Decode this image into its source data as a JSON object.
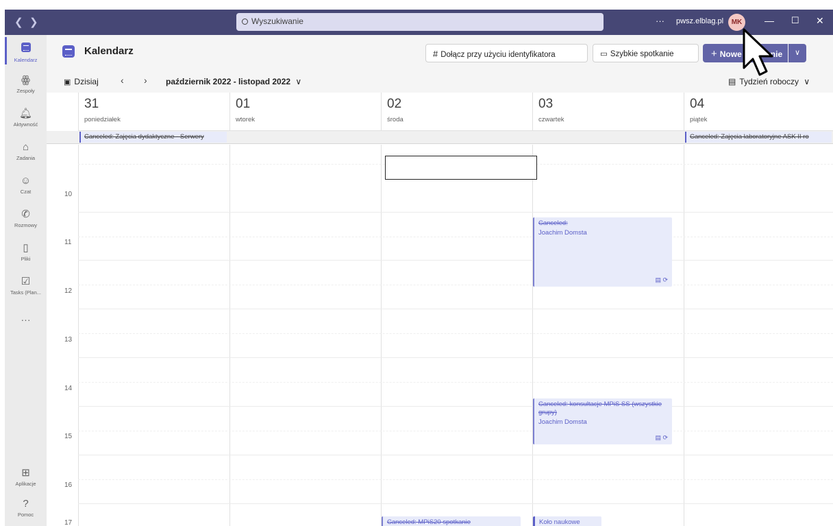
{
  "titlebar": {
    "back_icon": "chevron-left",
    "forward_icon": "chevron-right",
    "search_placeholder": "Wyszukiwanie",
    "more": "···",
    "tenant": "pwsz.elblag.pl",
    "avatar_initials": "MK",
    "minimize": "—",
    "maximize": "☐",
    "close": "✕"
  },
  "rail": {
    "items": [
      {
        "label": "Kalendarz",
        "icon": "calendar-icon",
        "glyph": "▦"
      },
      {
        "label": "Zespoły",
        "icon": "teams-icon",
        "glyph": "ꙮ"
      },
      {
        "label": "Aktywność",
        "icon": "bell-icon",
        "glyph": "🔔︎"
      },
      {
        "label": "Zadania",
        "icon": "tasks-icon",
        "glyph": "⌂"
      },
      {
        "label": "Czat",
        "icon": "chat-icon",
        "glyph": "☺"
      },
      {
        "label": "Rozmowy",
        "icon": "phone-icon",
        "glyph": "✆"
      },
      {
        "label": "Pliki",
        "icon": "file-icon",
        "glyph": "▯"
      },
      {
        "label": "Tasks (Plan...",
        "icon": "planner-icon",
        "glyph": "☑"
      }
    ],
    "more": "···",
    "apps": {
      "label": "Aplikacje",
      "icon": "apps-icon",
      "glyph": "⊞"
    },
    "help": {
      "label": "Pomoc",
      "icon": "help-icon",
      "glyph": "?"
    }
  },
  "header": {
    "title": "Kalendarz",
    "join_label": "Dołącz przy użyciu identyfikatora",
    "join_icon_glyph": "#",
    "quick_meeting_label": "Szybkie spotkanie",
    "quick_meeting_icon_glyph": "▭",
    "new_meeting_label": "Nowe spotkanie",
    "new_meeting_icon_glyph": "+",
    "dropdown_glyph": "∨"
  },
  "toolbar": {
    "today_label": "Dzisiaj",
    "today_icon_glyph": "▣",
    "prev_glyph": "‹",
    "next_glyph": "›",
    "range": "październik 2022 - listopad 2022",
    "range_chevron": "∨",
    "view_label": "Tydzień roboczy",
    "view_icon_glyph": "▤",
    "view_chevron": "∨"
  },
  "days": [
    {
      "num": "31",
      "name": "poniedziałek"
    },
    {
      "num": "01",
      "name": "wtorek"
    },
    {
      "num": "02",
      "name": "środa"
    },
    {
      "num": "03",
      "name": "czwartek"
    },
    {
      "num": "04",
      "name": "piątek"
    }
  ],
  "allday_events": [
    {
      "title": "Canceled: Zajęcia dydaktyczne - Serwery",
      "day": 0
    },
    {
      "title": "Canceled: Zajęcia laboratoryjne ASK II ro",
      "day": 4
    }
  ],
  "hours": [
    "10",
    "11",
    "12",
    "13",
    "14",
    "15",
    "16",
    "17"
  ],
  "events": [
    {
      "title": "Canceled:",
      "organizer": "Joachim Domsta",
      "day": 3,
      "icons": "▤ ⟳"
    },
    {
      "title": "Canceled: konsultacje MPiS SS (wszystkie grupy)",
      "organizer": "Joachim Domsta",
      "day": 3,
      "icons": "▤ ⟳"
    },
    {
      "title": "Canceled: MPiS20 spotkanie",
      "organizer": "",
      "day": 2,
      "icons": ""
    },
    {
      "title": "Koło naukowe",
      "organizer": "",
      "day": 3,
      "icons": ""
    }
  ]
}
